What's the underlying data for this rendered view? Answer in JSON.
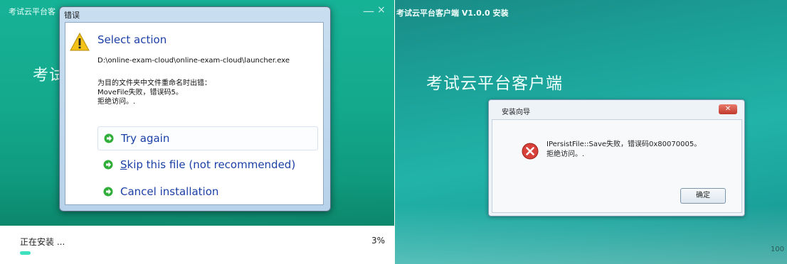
{
  "left": {
    "window_title": "考试云平台客",
    "minimize": "—",
    "close": "×",
    "big_title": "考试",
    "status": "正在安装 ...",
    "percent": "3%",
    "progress": 0.03,
    "dialog": {
      "title": "错误",
      "heading": "Select action",
      "path": "D:\\online-exam-cloud\\online-exam-cloud\\launcher.exe",
      "message": [
        "为目的文件夹中文件重命名时出错：",
        "MoveFile失败，错误码5。",
        "拒绝访问。."
      ],
      "options": [
        "Try again",
        "Skip this file (not recommended)",
        "Cancel installation"
      ]
    },
    "colors": {
      "bg": "#14a98d",
      "accent": "#3fe0c0",
      "link": "#1b3fa6"
    }
  },
  "right": {
    "window_title": "考试云平台客户端 V1.0.0 安装",
    "big_title": "考试云平台客户端",
    "dialog": {
      "title": "安装向导",
      "message": [
        "IPersistFile::Save失败，错误码0x80070005。",
        "拒绝访问。."
      ],
      "ok": "确定"
    },
    "corner_number": "100"
  }
}
